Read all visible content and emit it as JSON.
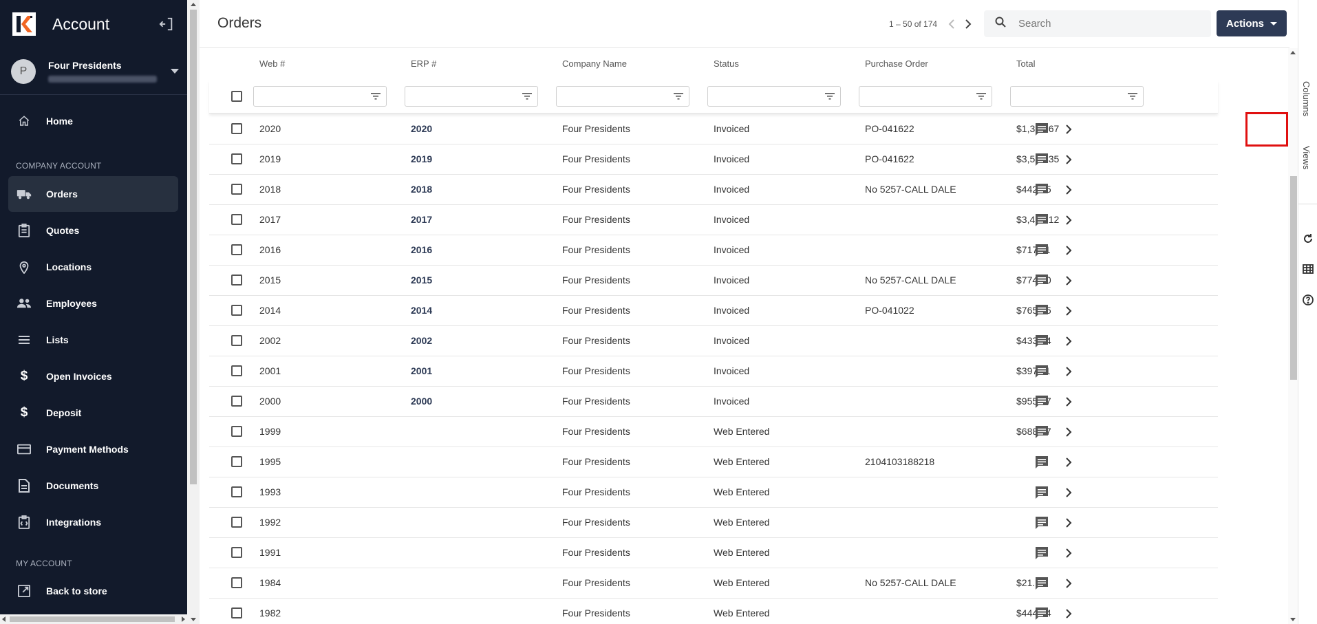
{
  "sidebar": {
    "title": "Account",
    "user": {
      "name": "Four Presidents",
      "avatar_letter": "P"
    },
    "sections": {
      "company": "COMPANY ACCOUNT",
      "my_account": "MY ACCOUNT"
    },
    "items": [
      {
        "label": "Home",
        "icon": "home-icon"
      },
      {
        "label": "Orders",
        "icon": "truck-icon",
        "active": true
      },
      {
        "label": "Quotes",
        "icon": "clipboard-icon"
      },
      {
        "label": "Locations",
        "icon": "map-pin-icon"
      },
      {
        "label": "Employees",
        "icon": "people-icon"
      },
      {
        "label": "Lists",
        "icon": "list-icon"
      },
      {
        "label": "Open Invoices",
        "icon": "dollar-icon"
      },
      {
        "label": "Deposit",
        "icon": "dollar-icon"
      },
      {
        "label": "Payment Methods",
        "icon": "credit-card-icon"
      },
      {
        "label": "Documents",
        "icon": "document-icon"
      },
      {
        "label": "Integrations",
        "icon": "integrations-icon"
      },
      {
        "label": "Back to store",
        "icon": "external-link-icon"
      }
    ]
  },
  "header": {
    "title": "Orders",
    "pagination": "1 – 50 of 174",
    "search_placeholder": "Search",
    "actions_label": "Actions"
  },
  "table": {
    "columns": [
      "Web #",
      "ERP #",
      "Company Name",
      "Status",
      "Purchase Order",
      "Total"
    ],
    "rows": [
      {
        "web": "2020",
        "erp": "2020",
        "company": "Four Presidents",
        "status": "Invoiced",
        "po": "PO-041622",
        "total": "$1,370.67"
      },
      {
        "web": "2019",
        "erp": "2019",
        "company": "Four Presidents",
        "status": "Invoiced",
        "po": "PO-041622",
        "total": "$3,585.35"
      },
      {
        "web": "2018",
        "erp": "2018",
        "company": "Four Presidents",
        "status": "Invoiced",
        "po": "No 5257-CALL DALE",
        "total": "$442.35"
      },
      {
        "web": "2017",
        "erp": "2017",
        "company": "Four Presidents",
        "status": "Invoiced",
        "po": "",
        "total": "$3,419.12"
      },
      {
        "web": "2016",
        "erp": "2016",
        "company": "Four Presidents",
        "status": "Invoiced",
        "po": "",
        "total": "$717.11"
      },
      {
        "web": "2015",
        "erp": "2015",
        "company": "Four Presidents",
        "status": "Invoiced",
        "po": "No 5257-CALL DALE",
        "total": "$774.90"
      },
      {
        "web": "2014",
        "erp": "2014",
        "company": "Four Presidents",
        "status": "Invoiced",
        "po": "PO-041022",
        "total": "$765.05"
      },
      {
        "web": "2002",
        "erp": "2002",
        "company": "Four Presidents",
        "status": "Invoiced",
        "po": "",
        "total": "$433.94"
      },
      {
        "web": "2001",
        "erp": "2001",
        "company": "Four Presidents",
        "status": "Invoiced",
        "po": "",
        "total": "$397.11"
      },
      {
        "web": "2000",
        "erp": "2000",
        "company": "Four Presidents",
        "status": "Invoiced",
        "po": "",
        "total": "$955.77"
      },
      {
        "web": "1999",
        "erp": "",
        "company": "Four Presidents",
        "status": "Web Entered",
        "po": "",
        "total": "$688.47"
      },
      {
        "web": "1995",
        "erp": "",
        "company": "Four Presidents",
        "status": "Web Entered",
        "po": "2104103188218",
        "total": ""
      },
      {
        "web": "1993",
        "erp": "",
        "company": "Four Presidents",
        "status": "Web Entered",
        "po": "",
        "total": ""
      },
      {
        "web": "1992",
        "erp": "",
        "company": "Four Presidents",
        "status": "Web Entered",
        "po": "",
        "total": ""
      },
      {
        "web": "1991",
        "erp": "",
        "company": "Four Presidents",
        "status": "Web Entered",
        "po": "",
        "total": ""
      },
      {
        "web": "1984",
        "erp": "",
        "company": "Four Presidents",
        "status": "Web Entered",
        "po": "No 5257-CALL DALE",
        "total": "$21.71"
      },
      {
        "web": "1982",
        "erp": "",
        "company": "Four Presidents",
        "status": "Web Entered",
        "po": "",
        "total": "$444.74"
      }
    ]
  },
  "rail": {
    "columns_label": "Columns",
    "views_label": "Views"
  },
  "colors": {
    "sidebar_bg": "#121a2b",
    "accent": "#2d3a55",
    "logo_orange": "#f26522",
    "highlight": "#e01010"
  }
}
